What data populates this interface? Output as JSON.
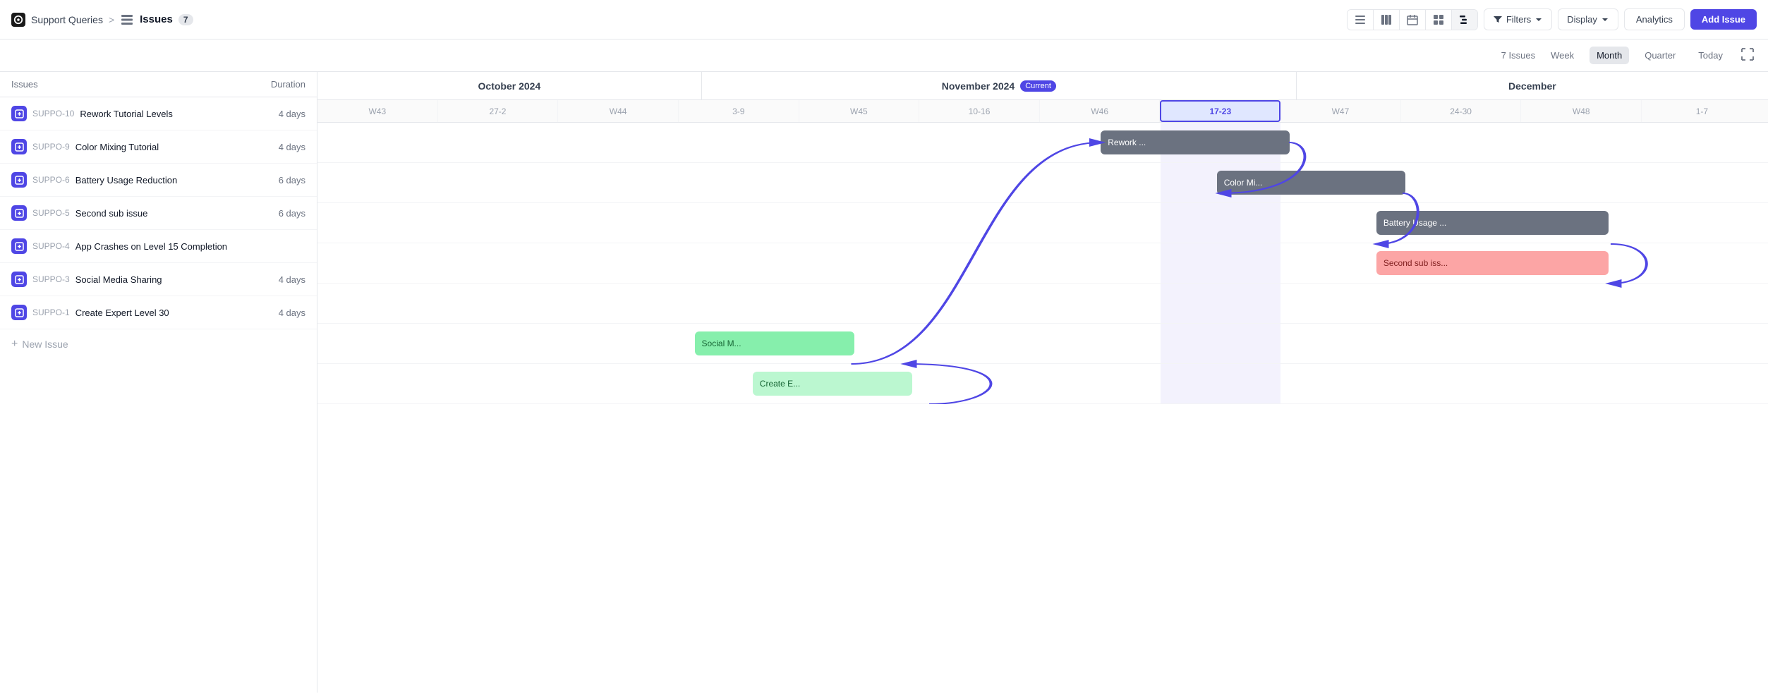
{
  "header": {
    "workspace_icon": "watch-icon",
    "workspace_label": "Support Queries",
    "breadcrumb_sep": ">",
    "issues_label": "Issues",
    "issues_count_badge": "7",
    "view_buttons": [
      {
        "id": "list",
        "label": "list-icon"
      },
      {
        "id": "board",
        "label": "board-icon"
      },
      {
        "id": "calendar",
        "label": "calendar-icon"
      },
      {
        "id": "grid",
        "label": "grid-icon"
      },
      {
        "id": "gantt",
        "label": "gantt-icon",
        "active": true
      }
    ],
    "filters_label": "Filters",
    "display_label": "Display",
    "analytics_label": "Analytics",
    "add_issue_label": "Add Issue"
  },
  "sub_header": {
    "issues_count_text": "7 Issues",
    "week_label": "Week",
    "month_label": "Month",
    "quarter_label": "Quarter",
    "today_label": "Today",
    "active_time": "Month"
  },
  "left_panel": {
    "col_issues": "Issues",
    "col_duration": "Duration",
    "issues": [
      {
        "id": "SUPPO-10",
        "name": "Rework Tutorial Levels",
        "duration": "4 days"
      },
      {
        "id": "SUPPO-9",
        "name": "Color Mixing Tutorial",
        "duration": "4 days"
      },
      {
        "id": "SUPPO-6",
        "name": "Battery Usage Reduction",
        "duration": "6 days"
      },
      {
        "id": "SUPPO-5",
        "name": "Second sub issue",
        "duration": "6 days"
      },
      {
        "id": "SUPPO-4",
        "name": "App Crashes on Level 15 Completion",
        "duration": ""
      },
      {
        "id": "SUPPO-3",
        "name": "Social Media Sharing",
        "duration": "4 days"
      },
      {
        "id": "SUPPO-1",
        "name": "Create Expert Level 30",
        "duration": "4 days"
      }
    ],
    "new_issue_label": "New Issue"
  },
  "gantt": {
    "months": [
      {
        "label": "October 2024",
        "width_pct": 32
      },
      {
        "label": "November 2024",
        "current": true,
        "current_label": "Current",
        "width_pct": 42
      },
      {
        "label": "December",
        "width_pct": 26
      }
    ],
    "weeks": [
      {
        "label": "W43",
        "current": false
      },
      {
        "label": "27-2",
        "current": false
      },
      {
        "label": "W44",
        "current": false
      },
      {
        "label": "3-9",
        "current": false
      },
      {
        "label": "W45",
        "current": false
      },
      {
        "label": "10-16",
        "current": false
      },
      {
        "label": "W46",
        "current": false
      },
      {
        "label": "17-23",
        "current": true
      },
      {
        "label": "W47",
        "current": false
      },
      {
        "label": "24-30",
        "current": false
      },
      {
        "label": "W48",
        "current": false
      },
      {
        "label": "1-7",
        "current": false
      }
    ],
    "tasks": [
      {
        "row": 0,
        "label": "Rework ...",
        "color": "gray",
        "left_pct": 56,
        "width_pct": 12
      },
      {
        "row": 1,
        "label": "Color Mi...",
        "color": "gray",
        "left_pct": 64,
        "width_pct": 12
      },
      {
        "row": 2,
        "label": "Battery Usage ...",
        "color": "gray",
        "left_pct": 74,
        "width_pct": 14
      },
      {
        "row": 3,
        "label": "Second sub iss...",
        "color": "red",
        "left_pct": 74,
        "width_pct": 14
      },
      {
        "row": 5,
        "label": "Social M...",
        "color": "green",
        "left_pct": 28,
        "width_pct": 11
      },
      {
        "row": 6,
        "label": "Create E...",
        "color": "light-green",
        "left_pct": 32,
        "width_pct": 11
      }
    ]
  }
}
